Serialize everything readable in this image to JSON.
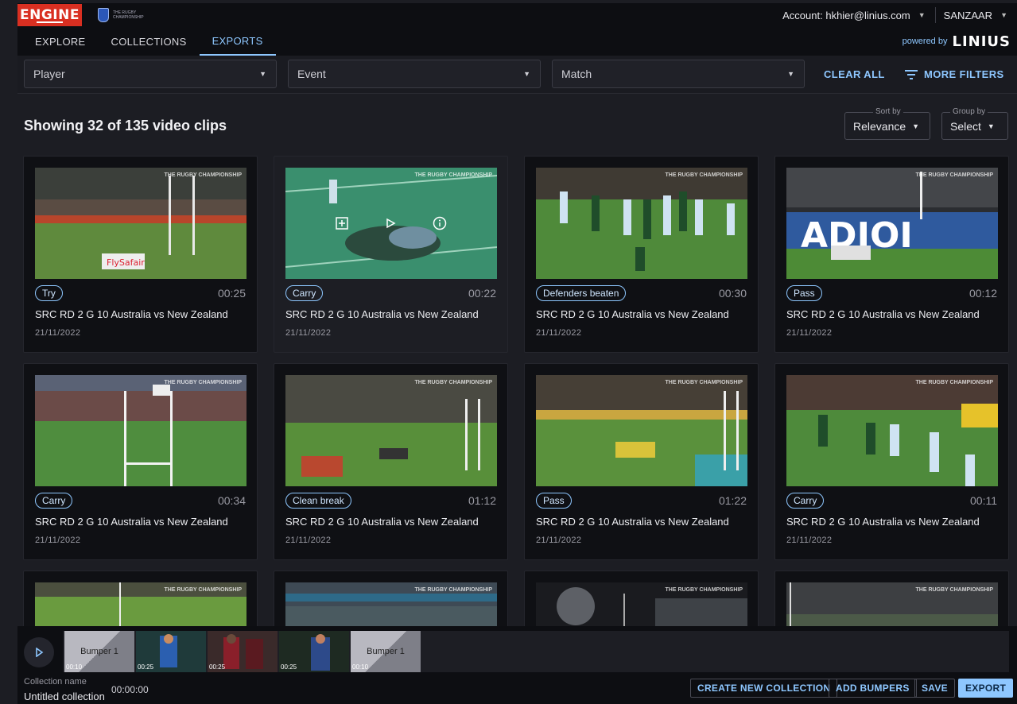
{
  "header": {
    "brand": "ENGINE",
    "account_label": "Account: hkhier@linius.com",
    "org": "SANZAAR"
  },
  "nav": {
    "tabs": [
      "EXPLORE",
      "COLLECTIONS",
      "EXPORTS"
    ],
    "active_tab": "EXPORTS",
    "powered_by": "powered by",
    "partner_logo": "LINIUS"
  },
  "filters": {
    "player": "Player",
    "event": "Event",
    "match": "Match",
    "clear_all": "CLEAR ALL",
    "more_filters": "MORE FILTERS"
  },
  "results": {
    "heading": "Showing 32 of 135 video clips",
    "sort_by_label": "Sort by",
    "sort_by_value": "Relevance",
    "group_by_label": "Group by",
    "group_by_value": "Select"
  },
  "clips": [
    {
      "tag": "Try",
      "duration": "00:25",
      "title": "SRC RD 2 G 10 Australia vs New Zealand",
      "date": "21/11/2022"
    },
    {
      "tag": "Carry",
      "duration": "00:22",
      "title": "SRC RD 2 G 10 Australia vs New Zealand",
      "date": "21/11/2022"
    },
    {
      "tag": "Defenders beaten",
      "duration": "00:30",
      "title": "SRC RD 2 G 10 Australia vs New Zealand",
      "date": "21/11/2022"
    },
    {
      "tag": "Pass",
      "duration": "00:12",
      "title": "SRC RD 2 G 10 Australia vs New Zealand",
      "date": "21/11/2022"
    },
    {
      "tag": "Carry",
      "duration": "00:34",
      "title": "SRC RD 2 G 10 Australia vs New Zealand",
      "date": "21/11/2022"
    },
    {
      "tag": "Clean break",
      "duration": "01:12",
      "title": "SRC RD 2 G 10 Australia vs New Zealand",
      "date": "21/11/2022"
    },
    {
      "tag": "Pass",
      "duration": "01:22",
      "title": "SRC RD 2 G 10 Australia vs New Zealand",
      "date": "21/11/2022"
    },
    {
      "tag": "Carry",
      "duration": "00:11",
      "title": "SRC RD 2 G 10 Australia vs New Zealand",
      "date": "21/11/2022"
    }
  ],
  "thumb_watermark": "THE RUGBY CHAMPIONSHIP",
  "timeline": {
    "items": [
      {
        "kind": "bumper",
        "label": "Bumper 1",
        "time": "00:10"
      },
      {
        "kind": "clip",
        "time": "00:25"
      },
      {
        "kind": "clip",
        "time": "00:25"
      },
      {
        "kind": "clip",
        "time": "00:25"
      },
      {
        "kind": "bumper",
        "label": "Bumper 1",
        "time": "00:10"
      }
    ]
  },
  "collection": {
    "name_label": "Collection name",
    "name": "Untitled collection",
    "total_time": "00:00:00"
  },
  "actions": {
    "create": "CREATE NEW COLLECTION",
    "bumpers": "ADD BUMPERS",
    "save": "SAVE",
    "export": "EXPORT"
  },
  "colors": {
    "accent": "#8ec7ff",
    "brand_red": "#d92f21",
    "background": "#1c1d23"
  }
}
